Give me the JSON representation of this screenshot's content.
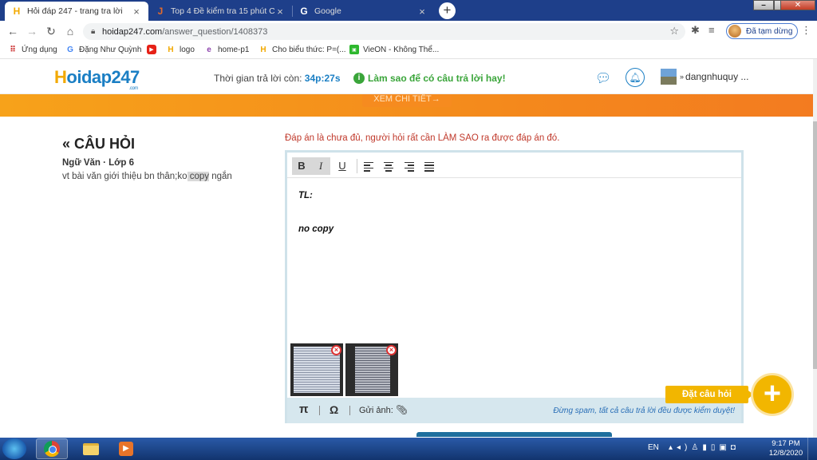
{
  "browser": {
    "tabs": [
      {
        "title": "Hỏi đáp 247 - trang tra lời",
        "favicon": "H"
      },
      {
        "title": "Top 4 Đề kiểm tra 15 phút Công",
        "favicon": "J"
      },
      {
        "title": "Google",
        "favicon": "G"
      }
    ],
    "url_host": "hoidap247.com",
    "url_path": "/answer_question/1408373",
    "pause_label": "Đã tạm dừng",
    "bookmarks": [
      "Ứng dụng",
      "Đặng Như Quỳnh",
      "",
      "logo",
      "home-p1",
      "Cho biểu thức: P=(...",
      "VieON - Không Thể..."
    ]
  },
  "header": {
    "logo": "Hoidap247",
    "logo_sub": ".com",
    "timer_label": "Thời gian trả lời còn:",
    "timer_value": "34p:27s",
    "tip": "Làm sao để có câu trả lời hay!",
    "username": "dangnhuquy ..."
  },
  "banner": {
    "button": "XEM CHI TIẾT→"
  },
  "question": {
    "title": "CÂU HỎI",
    "subject": "Ngữ Văn · Lớp 6",
    "text_before": "vt bài văn giới thiệu bn thân;ko",
    "text_highlight": " copy",
    "text_after": " ngắn"
  },
  "answer": {
    "warning": "Đáp án là chưa đủ, người hỏi rất cần LÀM SAO ra được đáp án đó.",
    "line1": "TL:",
    "line2": "no copy",
    "toolbar": {
      "bold": "B",
      "italic": "I",
      "underline": "U"
    },
    "footer": {
      "pi": "π",
      "omega": "Ω",
      "attach_label": "Gửi ảnh:"
    },
    "spam_note": "Đừng spam, tất cả câu trả lời đều được kiểm duyệt!"
  },
  "ask_button": "Đặt câu hỏi",
  "taskbar": {
    "lang": "EN",
    "time": "9:17 PM",
    "date": "12/8/2020"
  }
}
